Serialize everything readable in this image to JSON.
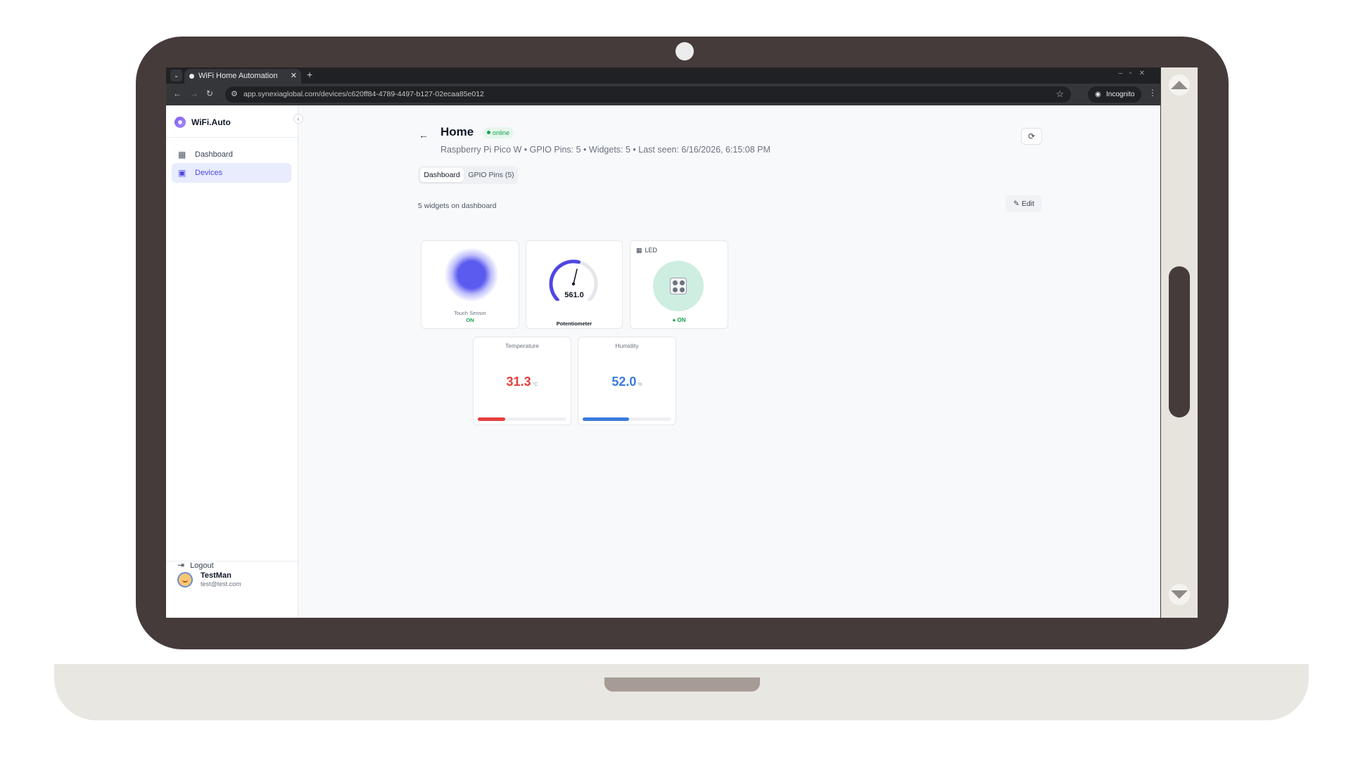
{
  "browser": {
    "tab_title": "WiFi Home Automation",
    "url": "app.synexiaglobal.com/devices/c620ff84-4789-4497-b127-02ecaa85e012",
    "incognito_label": "Incognito"
  },
  "sidebar": {
    "brand": "WiFi.Auto",
    "items": [
      {
        "label": "Dashboard",
        "icon": "grid-icon",
        "active": false
      },
      {
        "label": "Devices",
        "icon": "cpu-icon",
        "active": true
      }
    ],
    "user": {
      "name": "TestMan",
      "email": "test@test.com"
    },
    "logout_label": "Logout"
  },
  "header": {
    "title": "Home",
    "status": "online",
    "subtitle": "Raspberry Pi Pico W • GPIO Pins: 5 • Widgets: 5 • Last seen: 6/16/2026, 6:15:08 PM"
  },
  "tabs": [
    {
      "label": "Dashboard",
      "active": true
    },
    {
      "label": "GPIO Pins (5)",
      "active": false
    }
  ],
  "dashboard": {
    "widget_count_text": "5 widgets on dashboard",
    "edit_label": "Edit"
  },
  "widgets": {
    "touch": {
      "label": "Touch Sensor",
      "state": "ON",
      "color": "#5b5bf0"
    },
    "potentiometer": {
      "label": "Potentiometer",
      "value": "561.0",
      "fraction": 0.55,
      "color": "#4f46e5"
    },
    "led": {
      "label": "LED",
      "state": "● ON",
      "color": "#16a34a"
    },
    "temperature": {
      "label": "Temperature",
      "value": "31.3",
      "unit": "°C",
      "fraction": 0.31,
      "color": "#e53e3e"
    },
    "humidity": {
      "label": "Humidity",
      "value": "52.0",
      "unit": "%",
      "fraction": 0.52,
      "color": "#3b7be0"
    }
  },
  "colors": {
    "accent": "#4f46e5",
    "online": "#16a34a"
  }
}
